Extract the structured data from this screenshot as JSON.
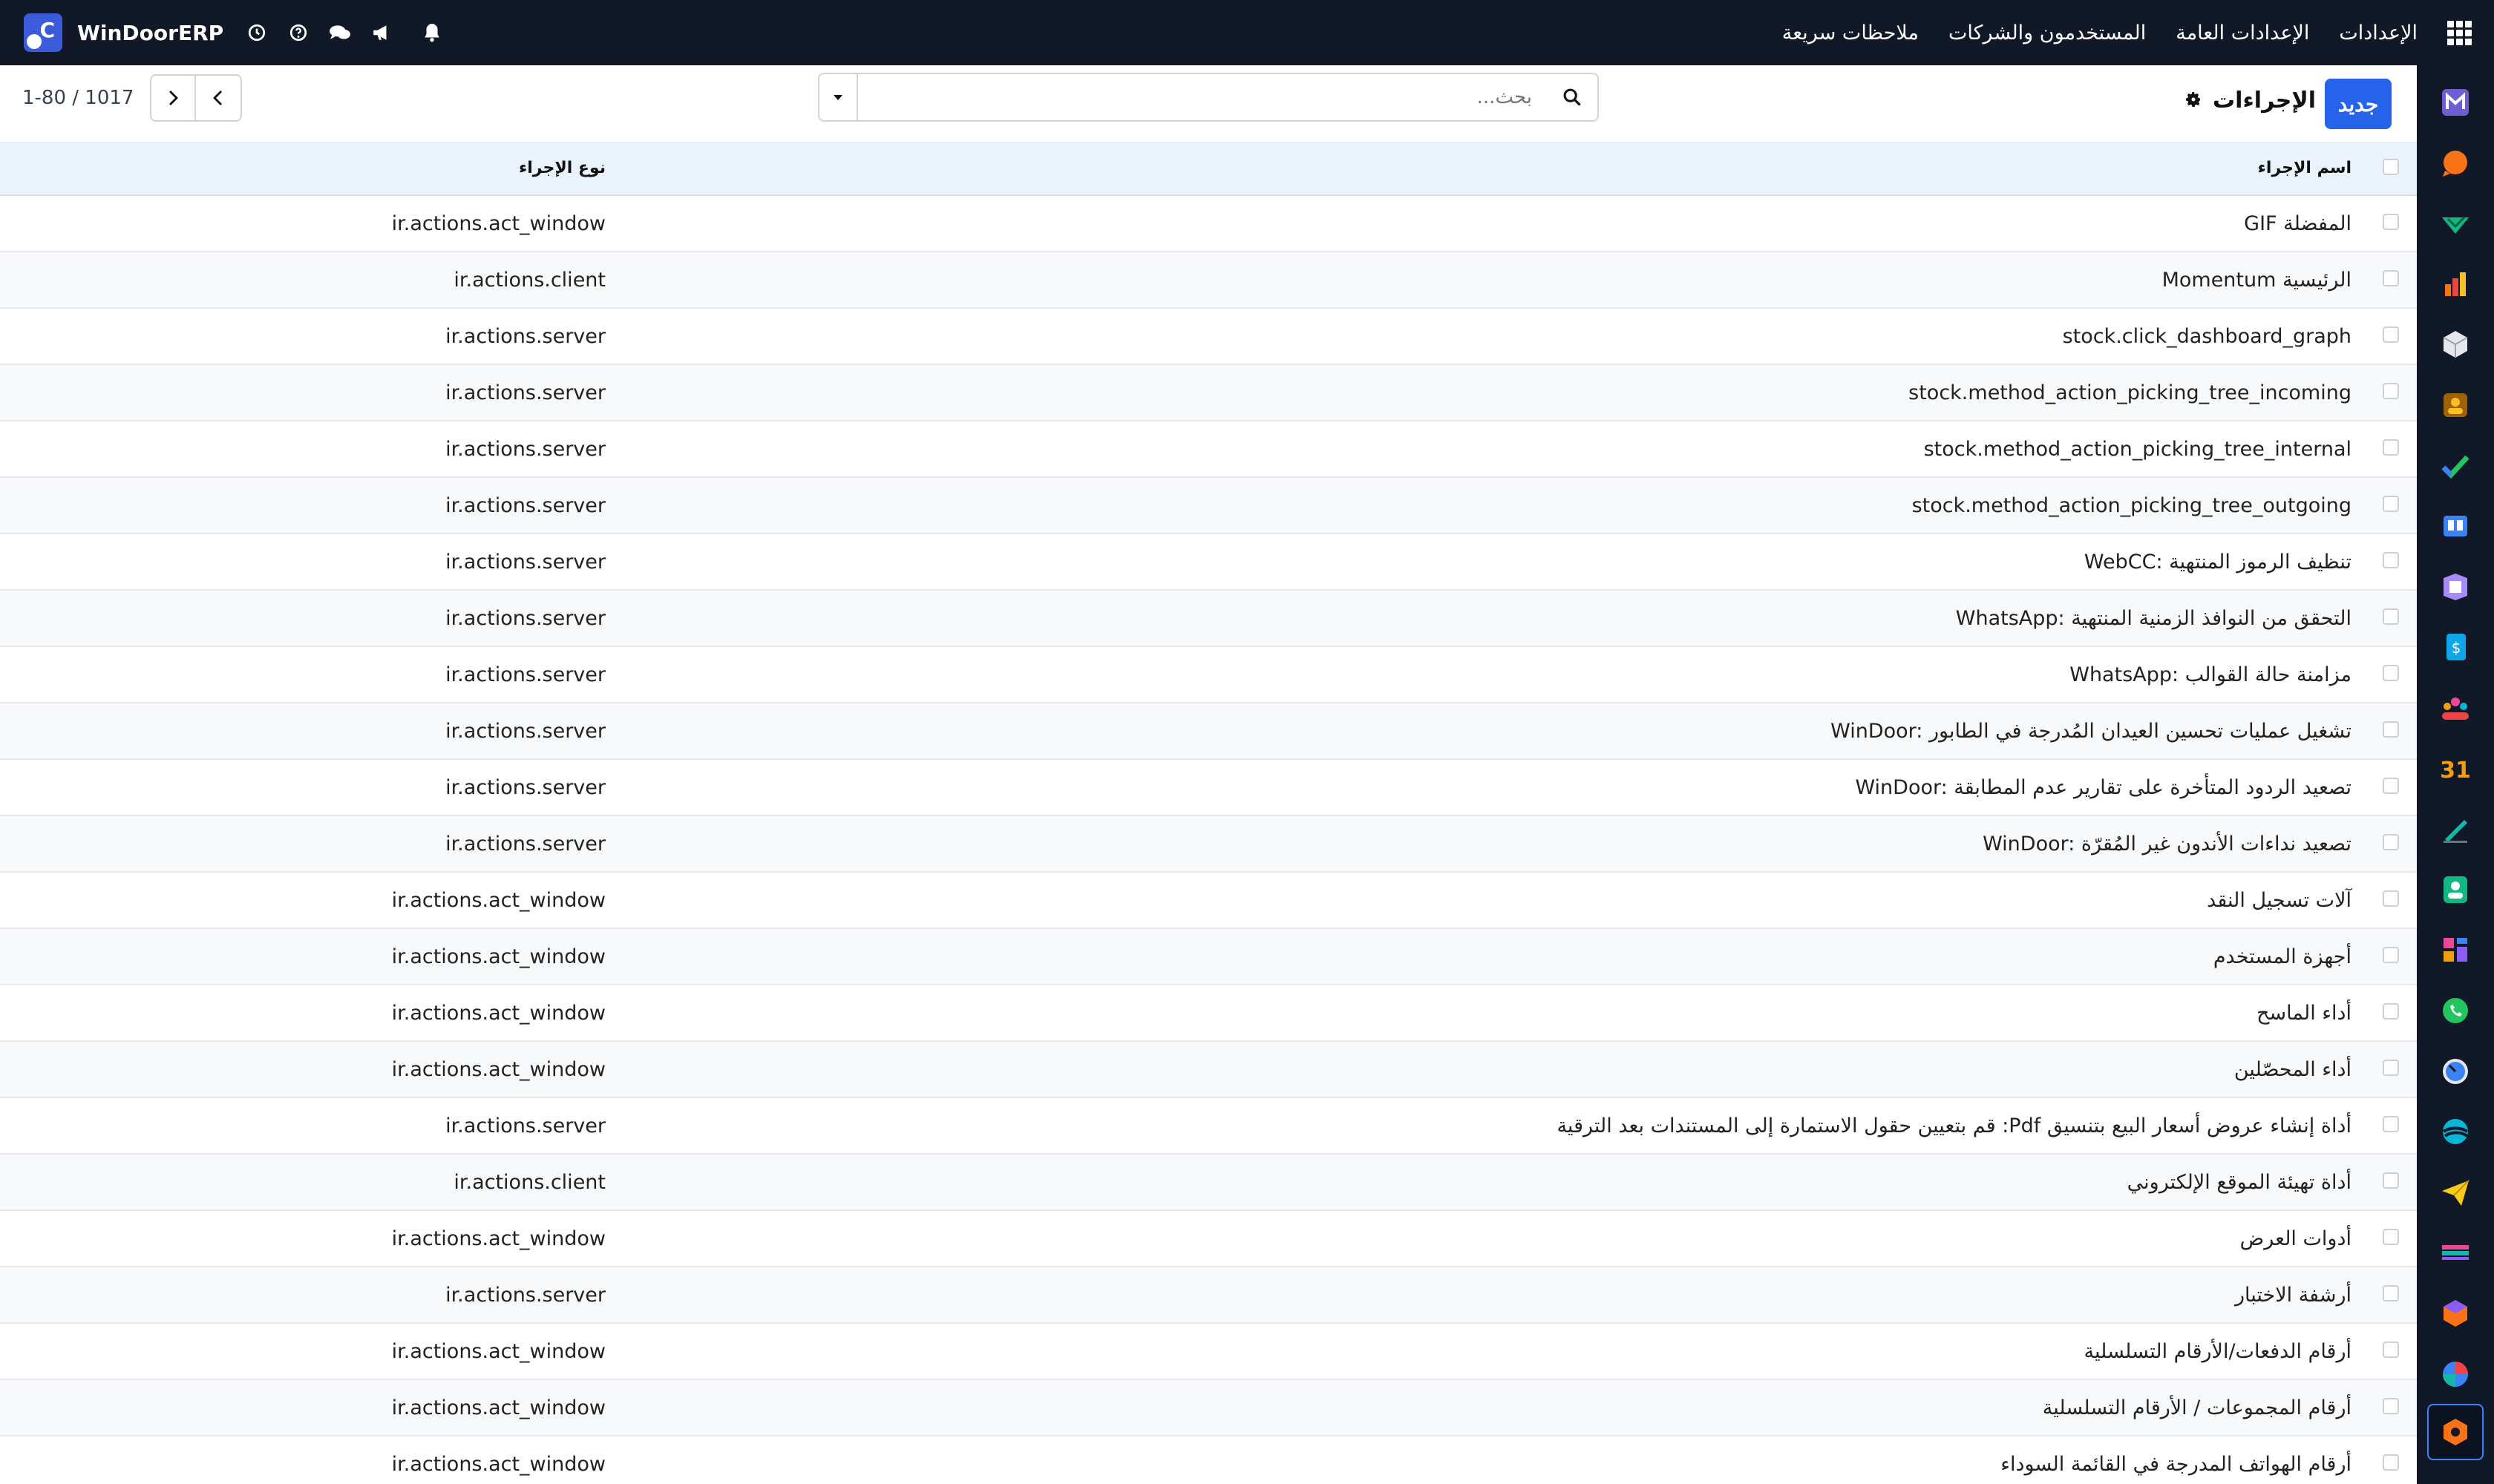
{
  "navbar": {
    "brand": "WinDoorERP",
    "menus": [
      "الإعدادات",
      "الإعدادات العامة",
      "المستخدمون والشركات",
      "ملاحظات سريعة"
    ],
    "icons": [
      "clock-icon",
      "help-icon",
      "chat-icon",
      "megaphone-icon",
      "bell-icon"
    ]
  },
  "controlbar": {
    "new_label": "جديد",
    "title": "الإجراءات",
    "search_placeholder": "بحث...",
    "pager": "1-80 / 1017"
  },
  "table": {
    "columns": {
      "name": "اسم الإجراء",
      "type": "نوع الإجراء"
    },
    "rows": [
      {
        "name": "GIF المفضلة",
        "type": "ir.actions.act_window"
      },
      {
        "name": "Momentum الرئيسية",
        "type": "ir.actions.client"
      },
      {
        "name": "stock.click_dashboard_graph",
        "type": "ir.actions.server"
      },
      {
        "name": "stock.method_action_picking_tree_incoming",
        "type": "ir.actions.server"
      },
      {
        "name": "stock.method_action_picking_tree_internal",
        "type": "ir.actions.server"
      },
      {
        "name": "stock.method_action_picking_tree_outgoing",
        "type": "ir.actions.server"
      },
      {
        "name": "WebCC: تنظيف الرموز المنتهية",
        "type": "ir.actions.server"
      },
      {
        "name": "WhatsApp: التحقق من النوافذ الزمنية المنتهية",
        "type": "ir.actions.server"
      },
      {
        "name": "WhatsApp: مزامنة حالة القوالب",
        "type": "ir.actions.server"
      },
      {
        "name": "WinDoor: تشغيل عمليات تحسين العيدان المُدرجة في الطابور",
        "type": "ir.actions.server"
      },
      {
        "name": "WinDoor: تصعيد الردود المتأخرة على تقارير عدم المطابقة",
        "type": "ir.actions.server"
      },
      {
        "name": "WinDoor: تصعيد نداءات الأندون غير المُقرّة",
        "type": "ir.actions.server"
      },
      {
        "name": "آلات تسجيل النقد",
        "type": "ir.actions.act_window"
      },
      {
        "name": "أجهزة المستخدم",
        "type": "ir.actions.act_window"
      },
      {
        "name": "أداء الماسح",
        "type": "ir.actions.act_window"
      },
      {
        "name": "أداء المحصّلين",
        "type": "ir.actions.act_window"
      },
      {
        "name": "أداة إنشاء عروض أسعار البيع بتنسيق Pdf: قم بتعيين حقول الاستمارة إلى المستندات بعد الترقية",
        "type": "ir.actions.server"
      },
      {
        "name": "أداة تهيئة الموقع الإلكتروني",
        "type": "ir.actions.client"
      },
      {
        "name": "أدوات العرض",
        "type": "ir.actions.act_window"
      },
      {
        "name": "أرشفة الاختبار",
        "type": "ir.actions.server"
      },
      {
        "name": "أرقام الدفعات/الأرقام التسلسلية",
        "type": "ir.actions.act_window"
      },
      {
        "name": "أرقام المجموعات / الأرقام التسلسلية",
        "type": "ir.actions.act_window"
      },
      {
        "name": "أرقام الهواتف المدرجة في القائمة السوداء",
        "type": "ir.actions.act_window"
      }
    ]
  },
  "sidebar": {
    "apps": [
      {
        "icon": "mail-m-icon",
        "color": "#6d5fd3"
      },
      {
        "icon": "chat-bubble-icon",
        "color": "#f97316"
      },
      {
        "icon": "diamond-check-icon",
        "color": "#10b981"
      },
      {
        "icon": "bar-chart-icon",
        "color": "#f97316"
      },
      {
        "icon": "cube-icon",
        "color": "#e5e7eb"
      },
      {
        "icon": "portrait-icon",
        "color": "#fbbf24"
      },
      {
        "icon": "checkmark-icon",
        "color": "#22c55e"
      },
      {
        "icon": "book-icon",
        "color": "#3b82f6"
      },
      {
        "icon": "box-icon",
        "color": "#a78bfa"
      },
      {
        "icon": "document-dollar-icon",
        "color": "#0ea5e9"
      },
      {
        "icon": "team-icon",
        "color": "#f59e0b"
      },
      {
        "icon": "calendar-31-icon",
        "color": "#f59e0b"
      },
      {
        "icon": "pen-icon",
        "color": "#14b8a6"
      },
      {
        "icon": "contact-card-icon",
        "color": "#10b981"
      },
      {
        "icon": "dashboard-icon",
        "color": "#ec4899"
      },
      {
        "icon": "whatsapp-icon",
        "color": "#22c55e"
      },
      {
        "icon": "gauge-icon",
        "color": "#3b82f6"
      },
      {
        "icon": "swirl-icon",
        "color": "#06b6d4"
      },
      {
        "icon": "paper-plane-icon",
        "color": "#facc15"
      },
      {
        "icon": "stripes-icon",
        "color": "#14b8a6"
      },
      {
        "icon": "hexagon-icon",
        "color": "#f97316"
      },
      {
        "icon": "pie-icon",
        "color": "#ef4444"
      },
      {
        "icon": "settings-hex-icon",
        "color": "#f97316"
      }
    ]
  }
}
